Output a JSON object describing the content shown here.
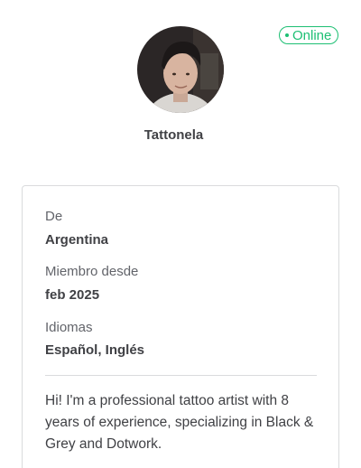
{
  "profile": {
    "status": "Online",
    "username": "Tattonela",
    "avatar_icon": "user-photo"
  },
  "details": {
    "from_label": "De",
    "from_value": "Argentina",
    "member_since_label": "Miembro desde",
    "member_since_value": "feb 2025",
    "languages_label": "Idiomas",
    "languages_value": "Español, Inglés"
  },
  "bio": "Hi! I'm a professional tattoo artist with 8 years of experience, specializing in Black & Grey and Dotwork.",
  "colors": {
    "online_accent": "#1dbf73",
    "text_primary": "#404145",
    "text_secondary": "#62646a",
    "border": "#dadbdd"
  }
}
